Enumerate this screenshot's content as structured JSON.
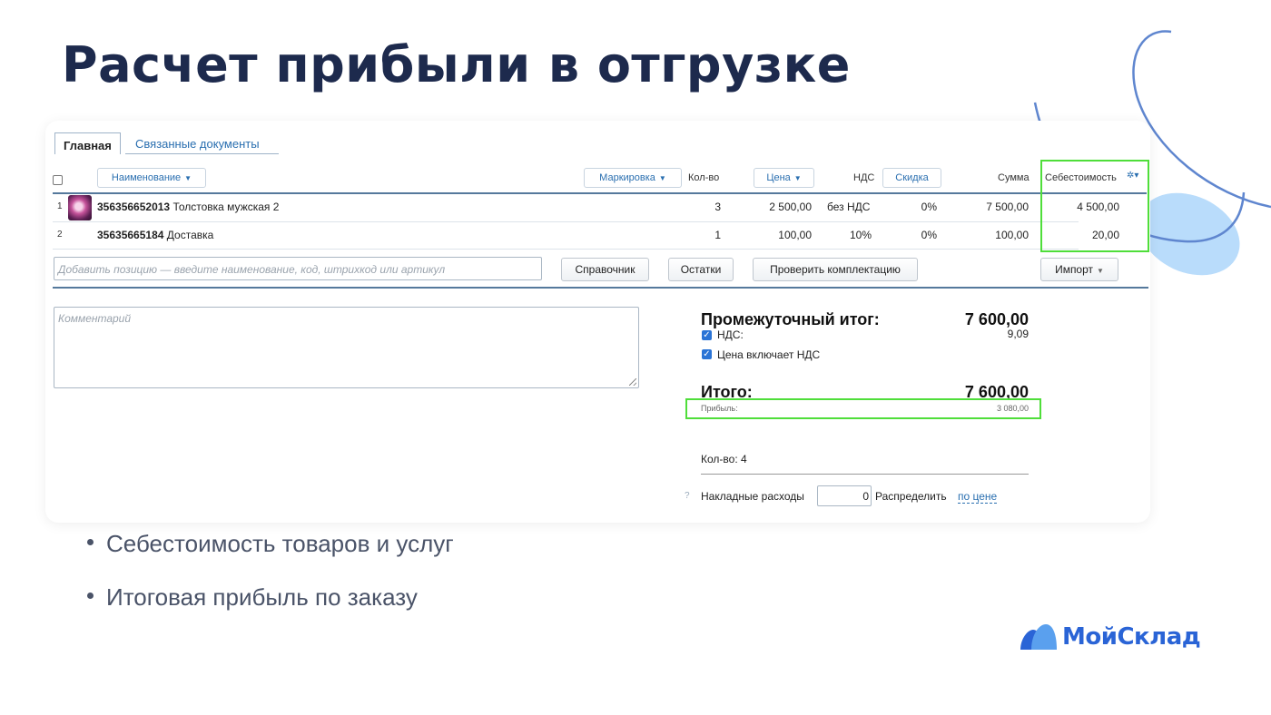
{
  "slide": {
    "title": "Расчет прибыли в отгрузке",
    "bullets": [
      "Себестоимость товаров и услуг",
      "Итоговая прибыль по заказу"
    ],
    "logo_text": "МойСклад",
    "colors": {
      "title": "#1d2a4d",
      "accent": "#2a64d6",
      "highlight": "#4fde3a"
    }
  },
  "tabs": {
    "main": "Главная",
    "linked": "Связанные документы"
  },
  "table": {
    "headers": {
      "name": "Наименование",
      "marking": "Маркировка",
      "qty": "Кол-во",
      "price": "Цена",
      "vat": "НДС",
      "discount": "Скидка",
      "sum": "Сумма",
      "cost": "Себестоимость"
    },
    "rows": [
      {
        "n": "1",
        "code": "356356652013",
        "name": "Толстовка мужская 2",
        "qty": "3",
        "price": "2 500,00",
        "vat": "без НДС",
        "discount": "0%",
        "sum": "7 500,00",
        "cost": "4 500,00"
      },
      {
        "n": "2",
        "code": "35635665184",
        "name": "Доставка",
        "qty": "1",
        "price": "100,00",
        "vat": "10%",
        "discount": "0%",
        "sum": "100,00",
        "cost": "20,00"
      }
    ]
  },
  "add_position": {
    "placeholder": "Добавить позицию — введите наименование, код, штрихкод или артикул",
    "buttons": {
      "reference": "Справочник",
      "stock": "Остатки",
      "check_kit": "Проверить комплектацию",
      "import": "Импорт"
    }
  },
  "comment": {
    "placeholder": "Комментарий"
  },
  "totals": {
    "subtotal_label": "Промежуточный итог:",
    "subtotal_value": "7 600,00",
    "vat_label": "НДС:",
    "vat_value": "9,09",
    "vat_checked": true,
    "price_incl_vat_label": "Цена включает НДС",
    "price_incl_vat_checked": true,
    "total_label": "Итого:",
    "total_value": "7 600,00",
    "profit_label": "Прибыль:",
    "profit_value": "3 080,00",
    "qty_label": "Кол-во: 4",
    "overhead_label": "Накладные расходы",
    "overhead_value": "0",
    "distribute_label": "Распределить",
    "distribute_link": "по цене"
  }
}
